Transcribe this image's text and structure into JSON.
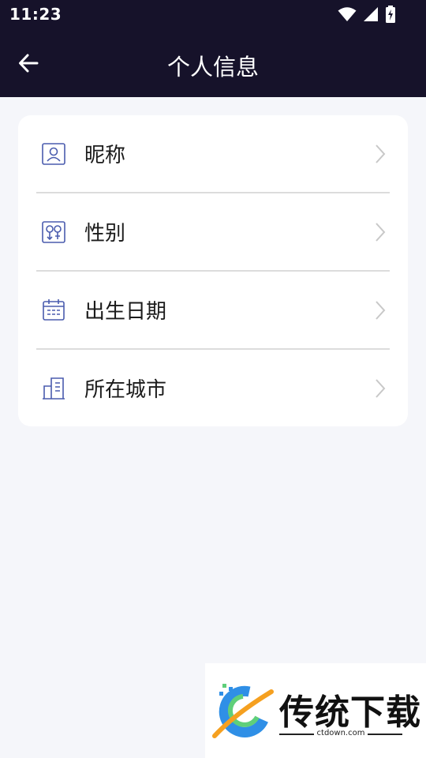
{
  "status_bar": {
    "time": "11:23",
    "icons": [
      "wifi-icon",
      "cellular-signal-icon",
      "battery-charging-icon"
    ]
  },
  "header": {
    "title": "个人信息",
    "back_icon": "arrow-left-icon"
  },
  "menu": {
    "items": [
      {
        "label": "昵称",
        "icon": "profile-card-icon"
      },
      {
        "label": "性别",
        "icon": "gender-icon"
      },
      {
        "label": "出生日期",
        "icon": "calendar-icon"
      },
      {
        "label": "所在城市",
        "icon": "building-icon"
      }
    ],
    "chevron_icon": "chevron-right-icon"
  },
  "watermark": {
    "brand": "传统下载",
    "url": "ctdown.com"
  },
  "colors": {
    "header_bg": "#16122a",
    "page_bg": "#f5f6fa",
    "icon_accent": "#4a5cae",
    "chevron": "#c8c8c8"
  }
}
